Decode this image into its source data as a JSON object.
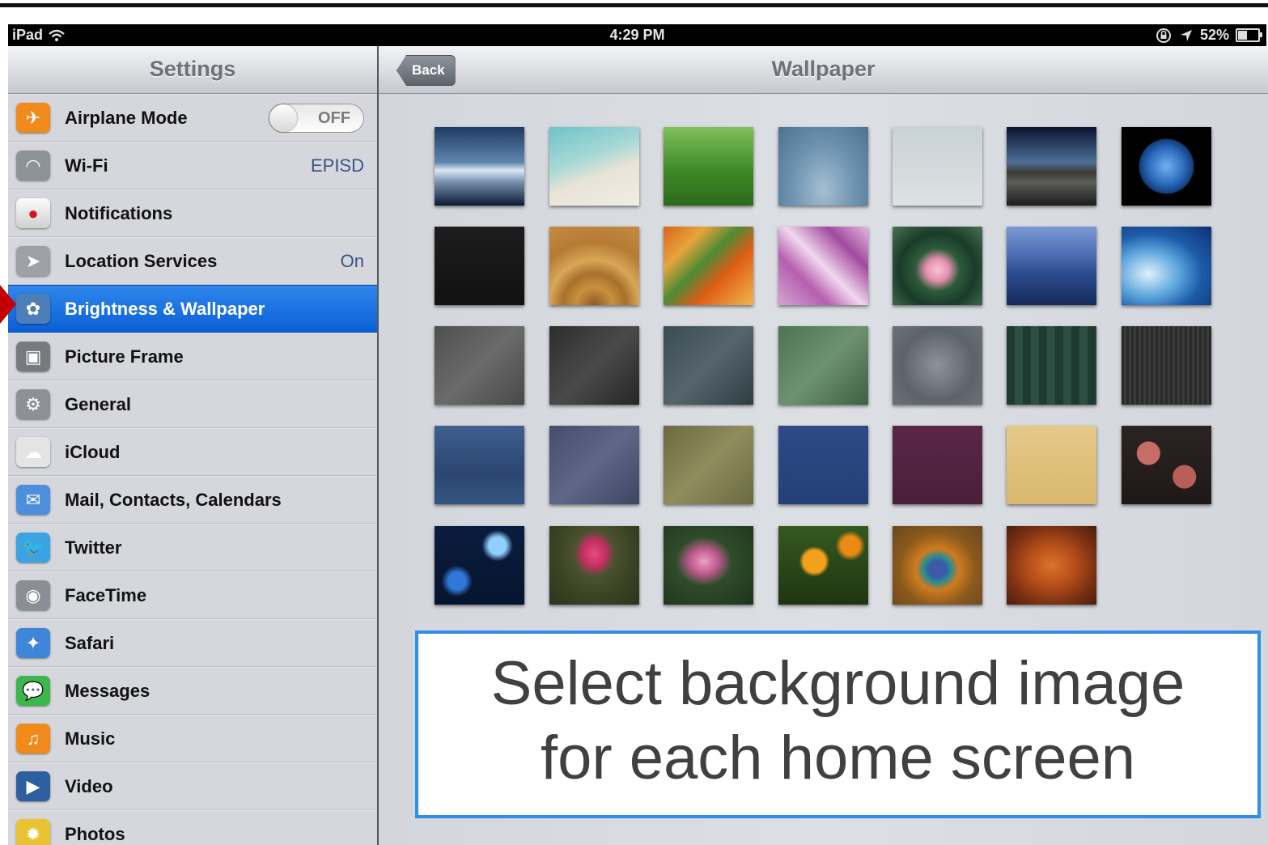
{
  "status_bar": {
    "device": "iPad",
    "time": "4:29 PM",
    "battery": "52%",
    "battery_level_pct": 52
  },
  "sidebar": {
    "title": "Settings",
    "items": [
      {
        "label": "Airplane Mode",
        "icon": "airplane-icon",
        "color": "#f08a1c",
        "toggle": "OFF"
      },
      {
        "label": "Wi-Fi",
        "icon": "wifi-icon",
        "color": "#8e9299",
        "value": "EPISD"
      },
      {
        "label": "Notifications",
        "icon": "notifications-icon",
        "color": "#c8c8c8"
      },
      {
        "label": "Location Services",
        "icon": "location-arrow-icon",
        "color": "#9ea2a8",
        "value": "On"
      },
      {
        "label": "Brightness & Wallpaper",
        "icon": "brightness-wallpaper-icon",
        "color": "#4c7fb9",
        "selected": true
      },
      {
        "label": "Picture Frame",
        "icon": "picture-frame-icon",
        "color": "#777b80"
      },
      {
        "label": "General",
        "icon": "gear-icon",
        "color": "#8d9197"
      },
      {
        "label": "iCloud",
        "icon": "cloud-icon",
        "color": "#e4e4e4"
      },
      {
        "label": "Mail, Contacts, Calendars",
        "icon": "mail-icon",
        "color": "#4d8fdd"
      },
      {
        "label": "Twitter",
        "icon": "twitter-bird-icon",
        "color": "#3ba2e3"
      },
      {
        "label": "FaceTime",
        "icon": "facetime-camera-icon",
        "color": "#8b8f95"
      },
      {
        "label": "Safari",
        "icon": "safari-compass-icon",
        "color": "#3f86d8"
      },
      {
        "label": "Messages",
        "icon": "messages-bubble-icon",
        "color": "#3db64b"
      },
      {
        "label": "Music",
        "icon": "music-note-icon",
        "color": "#ef8a1b"
      },
      {
        "label": "Video",
        "icon": "video-clapper-icon",
        "color": "#2d5f9e"
      },
      {
        "label": "Photos",
        "icon": "photos-sunflower-icon",
        "color": "#e8c332"
      }
    ]
  },
  "main": {
    "back_label": "Back",
    "title": "Wallpaper"
  },
  "wallpapers": [
    {
      "name": "wallpaper-blue-horizon",
      "bg": "linear-gradient(#1e3a63,#5f86ad 45%,#dbe8f3 55%,#7690ae 70%,#0d1a33)"
    },
    {
      "name": "wallpaper-beach-shore",
      "bg": "linear-gradient(160deg,#6fc3c9,#a8d9d6 40%,#e8e3d6 60%,#f1ede4)"
    },
    {
      "name": "wallpaper-green-grass",
      "bg": "linear-gradient(#7fc05a,#3f8a28 55%,#2c6a1a)"
    },
    {
      "name": "wallpaper-water-drops",
      "bg": "radial-gradient(ellipse at 50% 80%,#a6bfd2,#6e93b0 50%,#4c728f)"
    },
    {
      "name": "wallpaper-birds-sky",
      "bg": "linear-gradient(#c9d2d6,#dde2e3)"
    },
    {
      "name": "wallpaper-lake-dusk",
      "bg": "linear-gradient(#0b1530,#4d6e95 45%,#3a3a30 58%,#5a5d58 70%,#1c1c1c)"
    },
    {
      "name": "wallpaper-earth",
      "bg": "radial-gradient(circle at 50% 50%,#6fb2ef 0,#2c6bbd 30%,#133d7a 45%,#000 47%)"
    },
    {
      "name": "wallpaper-black-texture",
      "bg": "linear-gradient(#1d1d1d,#111)"
    },
    {
      "name": "wallpaper-wood-rings",
      "bg": "radial-gradient(circle at 50% 100%,#8b5a22,#c8903f 20%,#a7702c 35%,#d8a757 50%,#b57b33 70%,#c48c41)"
    },
    {
      "name": "wallpaper-maple-leaves",
      "bg": "linear-gradient(135deg,#d6641a,#e8a43b 25%,#4f8b34 45%,#e05c16 65%,#f0b84a)"
    },
    {
      "name": "wallpaper-pink-camo",
      "bg": "linear-gradient(45deg,#d7a5d5,#b45fae 30%,#f1d8ee 50%,#a24aa0 75%,#e4b8e0)"
    },
    {
      "name": "wallpaper-water-lily",
      "bg": "radial-gradient(ellipse at 50% 55%,#f6c5d4,#e58fae 18%,#2d5b3a 35%,#193b2a 60%,#4a7350)"
    },
    {
      "name": "wallpaper-blue-mountains",
      "bg": "linear-gradient(#7b9ad4,#4e6db4 35%,#2c4b8e 60%,#162a5b)"
    },
    {
      "name": "wallpaper-ocean-wave",
      "bg": "radial-gradient(ellipse at 30% 60%,#dff2fb,#5aa4dc 35%,#1d5ba8 60%,#0d3172)"
    },
    {
      "name": "wallpaper-gray-slate",
      "bg": "linear-gradient(135deg,#4f4f4f,#6b6b6b 50%,#484848)"
    },
    {
      "name": "wallpaper-dark-slate",
      "bg": "linear-gradient(135deg,#2d2d2d,#4a4a4a 50%,#262626)"
    },
    {
      "name": "wallpaper-chalkboard",
      "bg": "linear-gradient(135deg,#3b4c53,#55656b 50%,#2f3d43)"
    },
    {
      "name": "wallpaper-green-chalk",
      "bg": "linear-gradient(135deg,#4d7251,#6d9271 50%,#3e5f42)"
    },
    {
      "name": "wallpaper-cobblestone",
      "bg": "radial-gradient(circle,#8d939b 0,#5d636a 60%,#6c727a)"
    },
    {
      "name": "wallpaper-green-plaid",
      "bg": "repeating-linear-gradient(90deg,#1f3a30 0 10px,#2c4f42 10px 20px)"
    },
    {
      "name": "wallpaper-dark-stripes",
      "bg": "repeating-linear-gradient(90deg,#2a2a2a 0 3px,#3a3a3a 3px 6px)"
    },
    {
      "name": "wallpaper-denim",
      "bg": "linear-gradient(#3f5f8f,#2b4670 60%,#34557f)"
    },
    {
      "name": "wallpaper-asanoha-pattern",
      "bg": "linear-gradient(135deg,#444d6e,#5e6787 50%,#3c4563)"
    },
    {
      "name": "wallpaper-olive-pattern",
      "bg": "linear-gradient(135deg,#6b6a3e,#8f8d5e 50%,#6a6940)"
    },
    {
      "name": "wallpaper-navy-dots",
      "bg": "linear-gradient(#2e4a86,#234077)"
    },
    {
      "name": "wallpaper-plum-dots",
      "bg": "linear-gradient(#5b2648,#4a1f3b)"
    },
    {
      "name": "wallpaper-gold-paper",
      "bg": "linear-gradient(#e5c989,#d9b86e)"
    },
    {
      "name": "wallpaper-cherry-blossom",
      "bg": "radial-gradient(circle at 30% 35%,#c56d66 0 14%,transparent 15%),radial-gradient(circle at 70% 65%,#b95f5a 0 14%,transparent 15%),linear-gradient(#2b2322,#1e1918)"
    },
    {
      "name": "wallpaper-blue-bokeh",
      "bg": "radial-gradient(circle at 70% 25%,#8fd0ff 0 10%,transparent 18%),radial-gradient(circle at 25% 70%,#2f78d6 0 10%,transparent 18%),linear-gradient(#0a1d3f,#06142e)"
    },
    {
      "name": "wallpaper-pink-rose",
      "bg": "radial-gradient(ellipse at 50% 35%,#e54c7e 0,#c42e62 18%,#4a5230 32%,#3b4324 60%,#2d3420)"
    },
    {
      "name": "wallpaper-rose-bush",
      "bg": "radial-gradient(ellipse at 45% 45%,#e7a3c4 0,#c15a8f 20%,#2f4c2a 40%,#1e331c)"
    },
    {
      "name": "wallpaper-orange-poppies",
      "bg": "radial-gradient(circle at 40% 45%,#f3a11c 0 16%,transparent 22%),radial-gradient(circle at 80% 25%,#ec8b13 0 10%,transparent 16%),linear-gradient(#35591f,#1f3512)"
    },
    {
      "name": "wallpaper-peacock-feather",
      "bg": "radial-gradient(ellipse at 50% 55%,#3d5aa6 0 14%,#1f8c96 20%,#d07b1f 34%,#8a5a1c 60%,#6b4620)"
    },
    {
      "name": "wallpaper-tiki-carving",
      "bg": "radial-gradient(ellipse at 50% 50%,#d8742b 0,#b9501b 35%,#7a3012 70%,#4a1e0c)"
    }
  ],
  "callout": {
    "line1": "Select background image",
    "line2": "for each home screen"
  }
}
